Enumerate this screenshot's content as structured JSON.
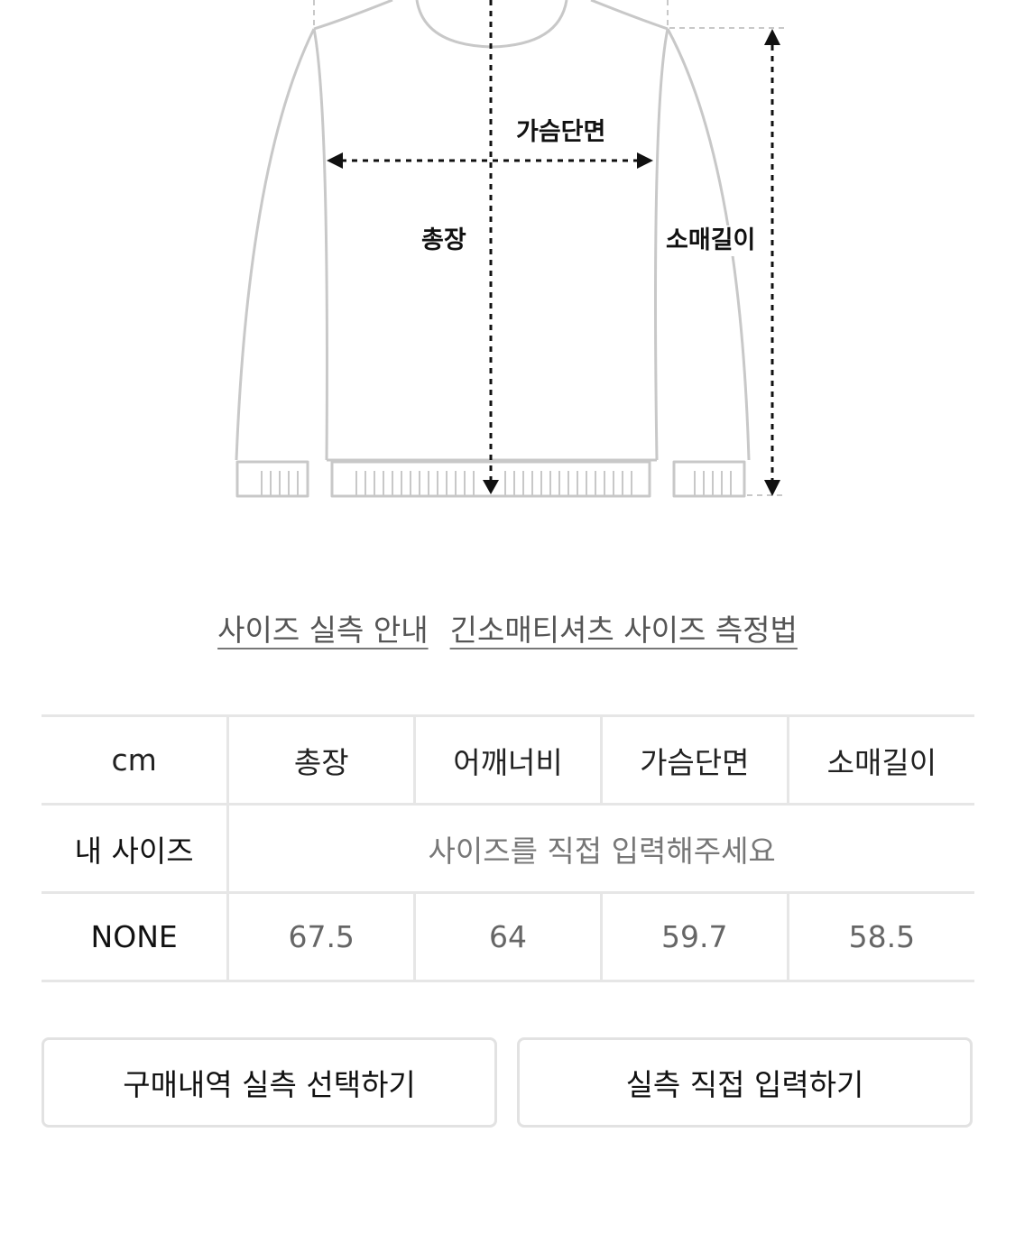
{
  "diagram": {
    "chest_label": "가슴단면",
    "length_label": "총장",
    "sleeve_label": "소매길이"
  },
  "links": {
    "size_guide": "사이즈 실측 안내",
    "measure_method": "긴소매티셔츠 사이즈 측정법"
  },
  "table": {
    "headers": [
      "cm",
      "총장",
      "어깨너비",
      "가슴단면",
      "소매길이"
    ],
    "my_size": {
      "label": "내 사이즈",
      "placeholder": "사이즈를 직접 입력해주세요"
    },
    "rows": [
      {
        "label": "NONE",
        "values": [
          "67.5",
          "64",
          "59.7",
          "58.5"
        ]
      }
    ]
  },
  "buttons": {
    "purchase_history": "구매내역 실측 선택하기",
    "manual_input": "실측 직접 입력하기"
  },
  "colors": {
    "outline": "#c8c8c8",
    "border": "#e6e6e6",
    "text": "#111111",
    "muted": "#666666"
  }
}
